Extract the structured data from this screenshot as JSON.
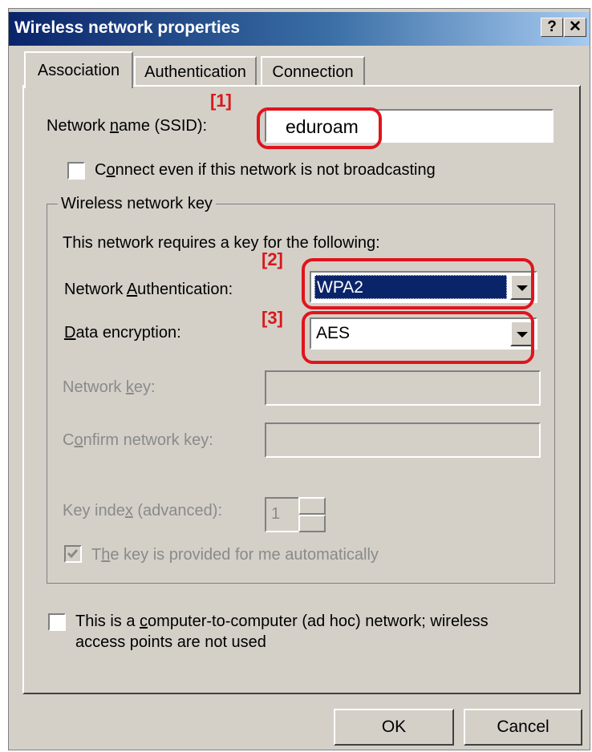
{
  "window": {
    "title": "Wireless network properties",
    "help_button": "?",
    "close_button": "✕"
  },
  "tabs": [
    {
      "label": "Association",
      "active": true
    },
    {
      "label": "Authentication",
      "active": false
    },
    {
      "label": "Connection",
      "active": false
    }
  ],
  "association": {
    "ssid_label_pre": "Network ",
    "ssid_label_key": "n",
    "ssid_label_post": "ame (SSID):",
    "ssid_value": "eduroam",
    "connect_hidden_pre": "C",
    "connect_hidden_key": "o",
    "connect_hidden_post": "nnect even if this network is not broadcasting",
    "connect_hidden_checked": false
  },
  "wireless_key": {
    "group_title": "Wireless network key",
    "requires_text": "This network requires a key for the following:",
    "auth_label_pre": "Network ",
    "auth_label_key": "A",
    "auth_label_post": "uthentication:",
    "auth_value": "WPA2",
    "enc_label_key": "D",
    "enc_label_post": "ata encryption:",
    "enc_value": "AES",
    "netkey_label_pre": "Network ",
    "netkey_label_key": "k",
    "netkey_label_post": "ey:",
    "confirm_label_pre": "C",
    "confirm_label_key": "o",
    "confirm_label_post": "nfirm network key:",
    "keyindex_label_pre": "Key inde",
    "keyindex_label_key": "x",
    "keyindex_label_post": " (advanced):",
    "keyindex_value": "1",
    "auto_key_pre": "T",
    "auto_key_key": "h",
    "auto_key_post": "e key is provided for me automatically",
    "auto_key_checked": true
  },
  "adhoc": {
    "line1_pre": "This is a ",
    "line1_key": "c",
    "line1_post": "omputer-to-computer (ad hoc) network; wireless",
    "line2": "access points are not used",
    "checked": false
  },
  "buttons": {
    "ok": "OK",
    "cancel": "Cancel"
  },
  "annotations": {
    "m1": "[1]",
    "m2": "[2]",
    "m3": "[3]",
    "color": "#e0141d"
  },
  "colors": {
    "titlebar_start": "#0a246a",
    "face": "#d4d0c8",
    "selection": "#0a246a"
  }
}
